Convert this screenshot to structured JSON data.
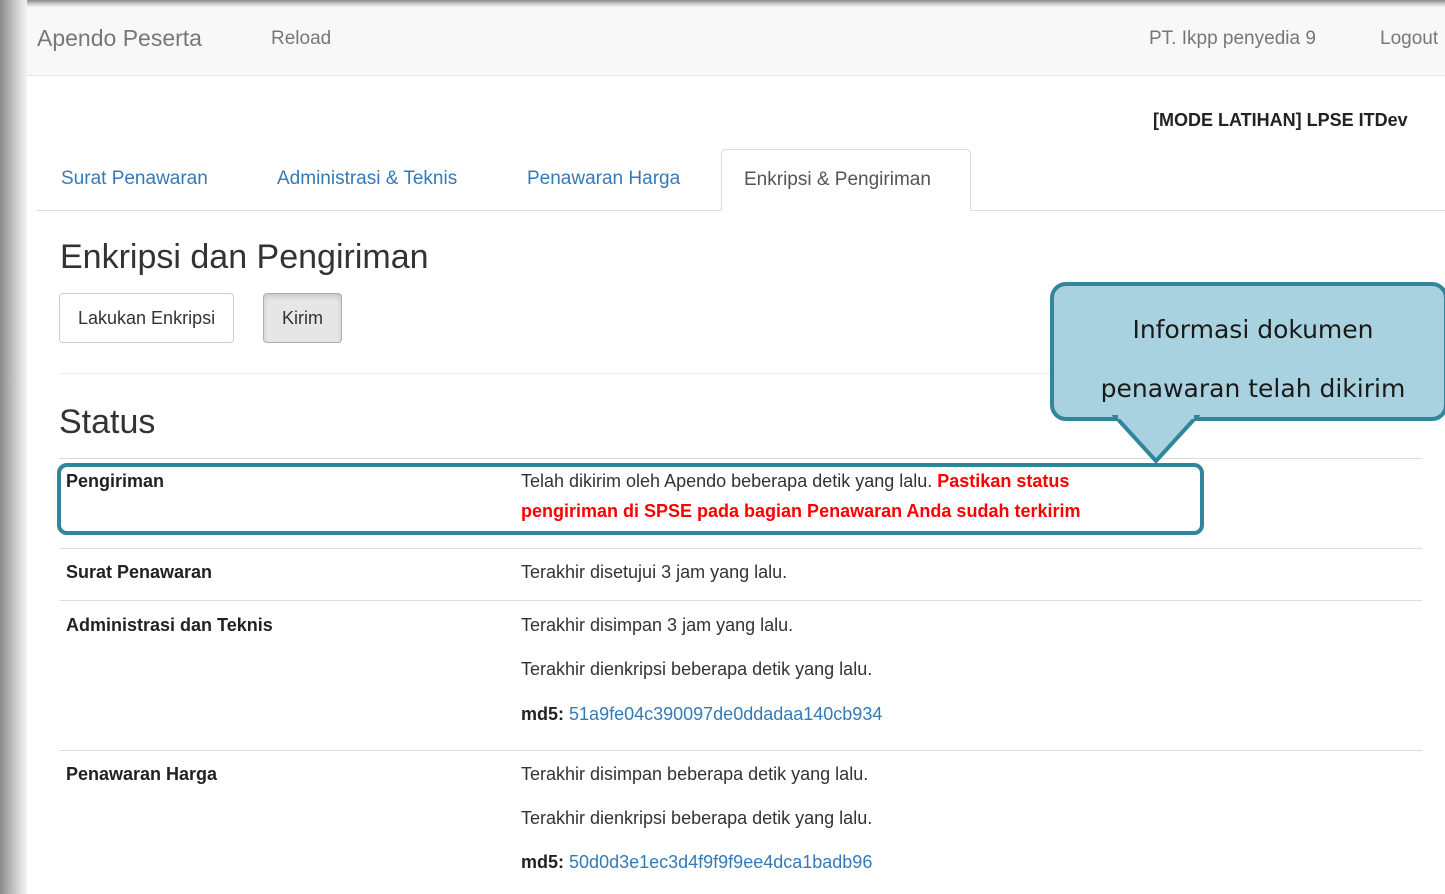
{
  "navbar": {
    "brand": "Apendo Peserta",
    "reload": "Reload",
    "user": "PT. Ikpp penyedia 9",
    "logout": "Logout"
  },
  "mode_title": "[MODE LATIHAN] LPSE ITDev",
  "tabs": [
    {
      "label": "Surat Penawaran",
      "active": false
    },
    {
      "label": "Administrasi & Teknis",
      "active": false
    },
    {
      "label": "Penawaran Harga",
      "active": false
    },
    {
      "label": "Enkripsi & Pengiriman",
      "active": true
    }
  ],
  "section_title": "Enkripsi dan Pengiriman",
  "buttons": {
    "encrypt": "Lakukan Enkripsi",
    "send": "Kirim"
  },
  "status": {
    "title": "Status",
    "rows": [
      {
        "label": "Pengiriman",
        "line1": "Telah dikirim oleh Apendo beberapa detik yang lalu. ",
        "warning1": "Pastikan status",
        "warning2": "pengiriman di SPSE pada bagian Penawaran Anda sudah terkirim"
      },
      {
        "label": "Surat Penawaran",
        "line1": "Terakhir disetujui 3 jam yang lalu."
      },
      {
        "label": "Administrasi dan Teknis",
        "line1": "Terakhir disimpan 3 jam yang lalu.",
        "line2": "Terakhir dienkripsi beberapa detik yang lalu.",
        "md5_label": "md5:",
        "md5": "51a9fe04c390097de0ddadaa140cb934"
      },
      {
        "label": "Penawaran Harga",
        "line1": "Terakhir disimpan beberapa detik yang lalu.",
        "line2": "Terakhir dienkripsi beberapa detik yang lalu.",
        "md5_label": "md5:",
        "md5": "50d0d3e1ec3d4f9f9f9ee4dca1badb96"
      }
    ]
  },
  "callout": {
    "line1": "Informasi dokumen",
    "line2": "penawaran telah dikirim"
  },
  "colors": {
    "link": "#337ab7",
    "warning": "#ff0000",
    "callout_fill": "#a9d2e0",
    "callout_border": "#31859c"
  }
}
